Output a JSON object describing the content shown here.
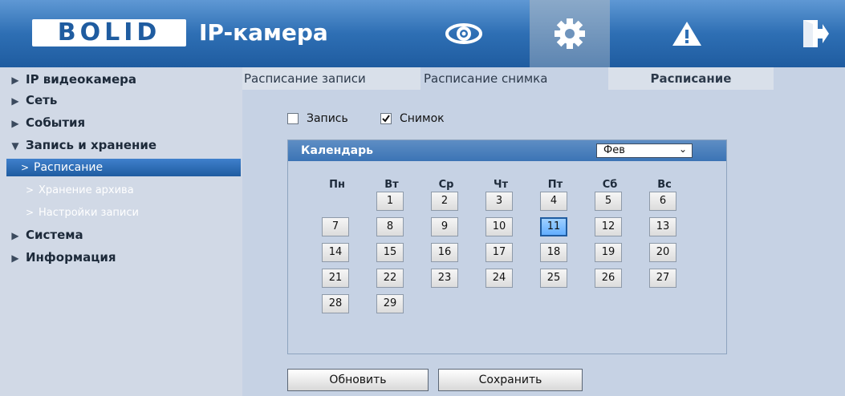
{
  "header": {
    "logo": "BOLID",
    "app_title": "IP-камера",
    "buttons": [
      {
        "icon": "eye-icon"
      },
      {
        "icon": "gear-icon"
      },
      {
        "icon": "warning-icon"
      },
      {
        "icon": "logout-icon"
      }
    ]
  },
  "sidebar": {
    "items": [
      {
        "label": "IP видеокамера"
      },
      {
        "label": "Сеть"
      },
      {
        "label": "События"
      },
      {
        "label": "Запись и хранение"
      },
      {
        "label": "Система"
      },
      {
        "label": "Информация"
      }
    ],
    "subitems": [
      {
        "label": "Расписание"
      },
      {
        "label": "Хранение архива"
      },
      {
        "label": "Настройки записи"
      }
    ]
  },
  "tabs": [
    {
      "label": "Расписание записи"
    },
    {
      "label": "Расписание снимка"
    },
    {
      "label": "Расписание"
    }
  ],
  "checkboxes": [
    {
      "label": "Запись",
      "checked": false
    },
    {
      "label": "Снимок",
      "checked": true
    }
  ],
  "calendar": {
    "title": "Календарь",
    "month": "Фев",
    "weekdays": [
      "Пн",
      "Вт",
      "Ср",
      "Чт",
      "Пт",
      "Сб",
      "Вс"
    ],
    "days": [
      "1",
      "2",
      "3",
      "4",
      "5",
      "6",
      "7",
      "8",
      "9",
      "10",
      "11",
      "12",
      "13",
      "14",
      "15",
      "16",
      "17",
      "18",
      "19",
      "20",
      "21",
      "22",
      "23",
      "24",
      "25",
      "26",
      "27",
      "28",
      "29"
    ],
    "selected_day": "11"
  },
  "actions": {
    "refresh": "Обновить",
    "save": "Сохранить"
  },
  "colors": {
    "header": "#2e6fb4",
    "sidebar": "#d1d9e6",
    "main": "#c6d2e4",
    "selected_day": "#62aeff"
  }
}
